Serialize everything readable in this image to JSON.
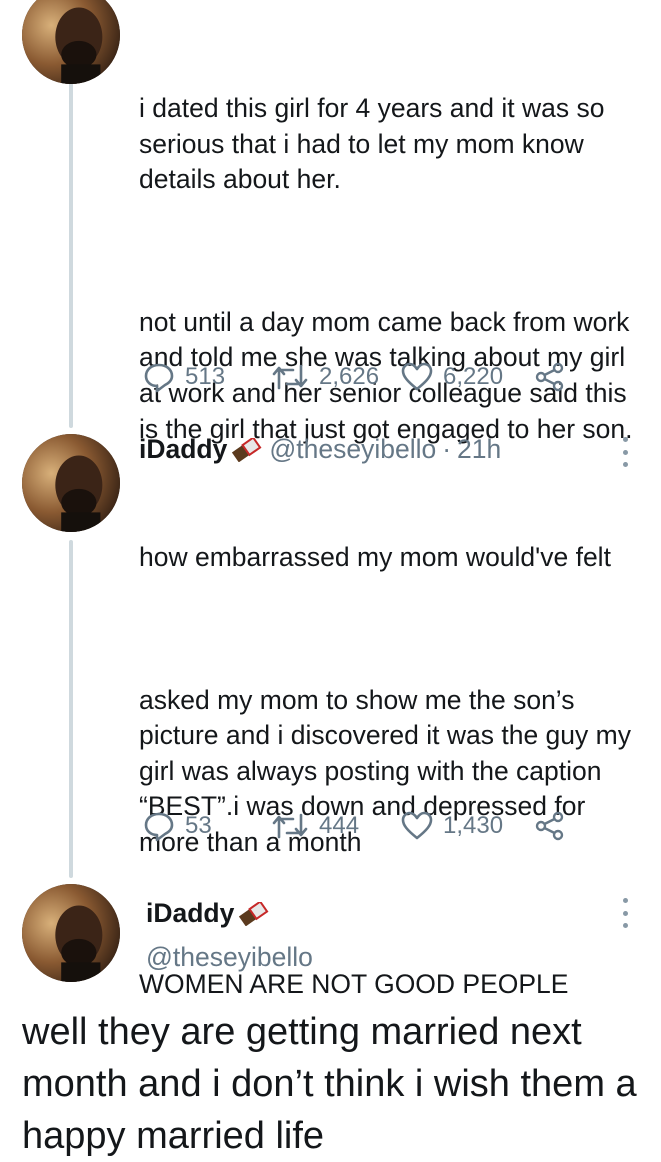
{
  "tweet1": {
    "paragraphs": [
      "i dated this girl for 4 years and it was so serious that i had to let my mom know details about her.",
      "not until a day mom came back from work and told me she was talking about my girl at work and her senior colleague said this is the girl that just got engaged to her son."
    ],
    "replies": "513",
    "retweets": "2,626",
    "likes": "6,220"
  },
  "tweet2": {
    "display_name": "iDaddy",
    "handle": "@theseyibello",
    "separator": "·",
    "time": "21h",
    "paragraphs": [
      "how embarrassed my mom would've felt",
      "asked my mom to show me the son’s picture and i discovered it was the guy my girl was always posting with the caption “BEST”.i was down and depressed for more than a month",
      "WOMEN ARE NOT GOOD PEOPLE"
    ],
    "replies": "53",
    "retweets": "444",
    "likes": "1,430"
  },
  "tweet3": {
    "display_name": "iDaddy",
    "handle": "@theseyibello",
    "text": "well they are getting married next month and i don’t think i wish them a happy married life"
  },
  "icons": {
    "reply": "reply-icon",
    "retweet": "retweet-icon",
    "like": "heart-icon",
    "share": "share-icon",
    "more": "more-vertical-icon",
    "emoji": "chocolate-bar-icon"
  },
  "colors": {
    "text": "#14171a",
    "muted": "#657786",
    "thread_line": "#cfd9de",
    "chocolate": "#5b3a1e"
  }
}
